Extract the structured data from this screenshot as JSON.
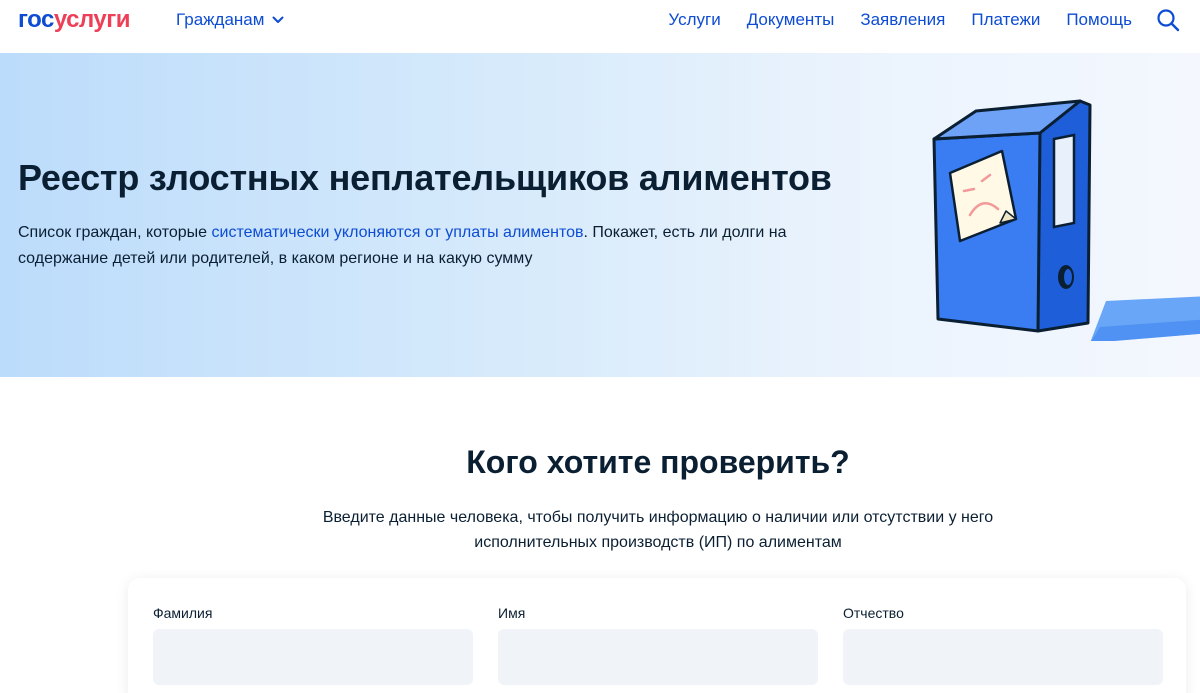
{
  "header": {
    "logo_part1": "гос",
    "logo_part2": "услуги",
    "audience": "Гражданам",
    "nav": [
      "Услуги",
      "Документы",
      "Заявления",
      "Платежи",
      "Помощь"
    ]
  },
  "hero": {
    "title": "Реестр злостных неплательщиков алиментов",
    "desc_before": "Список граждан, которые ",
    "desc_link": "систематически уклоняются от уплаты алиментов",
    "desc_after": ". Покажет, есть ли долги на содержание детей или родителей, в каком регионе и на какую сумму"
  },
  "main": {
    "title": "Кого хотите проверить?",
    "subtitle": "Введите данные человека, чтобы получить информацию о наличии или отсутствии у него исполнительных производств (ИП) по алиментам",
    "fields": [
      {
        "label": "Фамилия",
        "value": ""
      },
      {
        "label": "Имя",
        "value": ""
      },
      {
        "label": "Отчество",
        "value": ""
      }
    ]
  },
  "colors": {
    "primary": "#0d4cd3",
    "brand_red": "#ee3f58",
    "text": "#0b1f33",
    "input_bg": "#f0f4f9"
  },
  "icons": {
    "audience_chevron": "chevron-down-icon",
    "search": "search-icon",
    "illustration": "binder-with-sad-sticky-note"
  }
}
